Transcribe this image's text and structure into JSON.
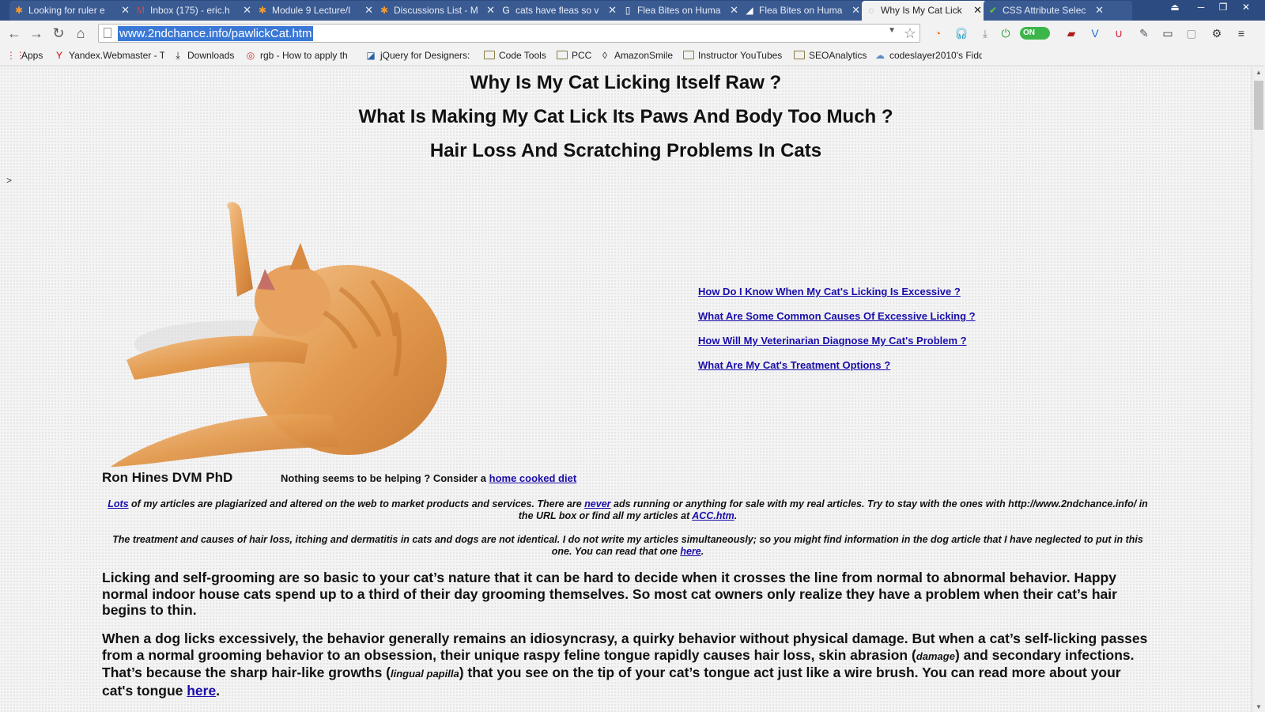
{
  "browser": {
    "tabs": [
      {
        "title": "Looking for ruler e",
        "icon": "snowflake-icon",
        "active": false
      },
      {
        "title": "Inbox (175) - eric.h",
        "icon": "gmail-icon",
        "active": false
      },
      {
        "title": "Module 9 Lecture/I",
        "icon": "snowflake-icon",
        "active": false
      },
      {
        "title": "Discussions List - M",
        "icon": "snowflake-icon",
        "active": false
      },
      {
        "title": "cats have fleas so v",
        "icon": "google-icon",
        "active": false
      },
      {
        "title": "Flea Bites on Huma",
        "icon": "page-icon",
        "active": false
      },
      {
        "title": "Flea Bites on Huma",
        "icon": "page-icon",
        "active": false
      },
      {
        "title": "Why Is My Cat Lick",
        "icon": "loading-icon",
        "active": true
      },
      {
        "title": "CSS Attribute Selec",
        "icon": "checkmark-icon",
        "active": false
      }
    ],
    "url": "www.2ndchance.info/pawlickCat.htm",
    "toggle_label": "ON",
    "bookmarks": [
      {
        "label": "Apps",
        "icon": "apps-grid-icon"
      },
      {
        "label": "Yandex.Webmaster - T",
        "icon": "yandex-icon"
      },
      {
        "label": "Downloads",
        "icon": "download-icon"
      },
      {
        "label": "rgb - How to apply th",
        "icon": "stackexchange-icon"
      },
      {
        "label": "jQuery for Designers:",
        "icon": "jquery-icon"
      },
      {
        "label": "Code Tools",
        "icon": "folder-icon"
      },
      {
        "label": "PCC",
        "icon": "folder-icon"
      },
      {
        "label": "AmazonSmile",
        "icon": "amazon-icon"
      },
      {
        "label": "Instructor YouTubes",
        "icon": "folder-icon"
      },
      {
        "label": "SEOAnalytics",
        "icon": "folder-icon"
      },
      {
        "label": "codeslayer2010's Fidd",
        "icon": "fiddle-icon"
      }
    ]
  },
  "page": {
    "title1": "Why Is My Cat Licking Itself Raw ?",
    "title2": "What Is Making My Cat Lick Its Paws And Body Too Much ?",
    "title3": "Hair Loss And Scratching Problems In Cats",
    "marker": ">",
    "toc": [
      "How Do I Know When My Cat's Licking Is Excessive ?",
      "What Are Some Common Causes Of Excessive Licking ?",
      "How Will My Veterinarian Diagnose My Cat's Problem ?",
      "What Are My Cat's Treatment Options ?"
    ],
    "author": "Ron Hines DVM PhD",
    "help_text": "Nothing seems to be helping ? Consider a ",
    "help_link": "home cooked diet",
    "note1": {
      "link1": "Lots",
      "text1": " of my articles are plagiarized and altered on the web to market products and services. There are ",
      "link2": "never",
      "text2": " ads running or anything for sale with my real articles. Try to stay with the ones with http://www.2ndchance.info/ in the URL box or find all my articles at ",
      "link3": "ACC.htm",
      "text3": "."
    },
    "note2": {
      "text": "The treatment and causes of hair loss, itching and dermatitis in cats and dogs are not identical. I do not write my articles simultaneously; so you might find information in the dog article that I have neglected to put in this one. You can read that one ",
      "link": "here",
      "end": "."
    },
    "para1": "Licking and self-grooming are so basic to your cat’s nature that it can be hard to decide when it crosses the line from normal to abnormal behavior. Happy normal indoor house cats spend up to a third of their day grooming themselves. So most cat owners only realize they have a problem when their cat’s hair begins to thin.",
    "para2": {
      "t1": "When a dog licks excessively, the behavior generally remains an idiosyncrasy, a quirky behavior without physical damage. But when a cat’s self-licking passes from a normal grooming behavior to an obsession, their unique raspy feline tongue rapidly causes hair loss, skin abrasion (",
      "s1": "damage",
      "t2": ") and secondary infections. That’s because the sharp hair-like growths (",
      "s2": "lingual papilla",
      "t3": ") that you see on the tip of your cat’s tongue act just like a wire brush. You can read more about your cat's tongue ",
      "link": "here",
      "t4": "."
    }
  }
}
